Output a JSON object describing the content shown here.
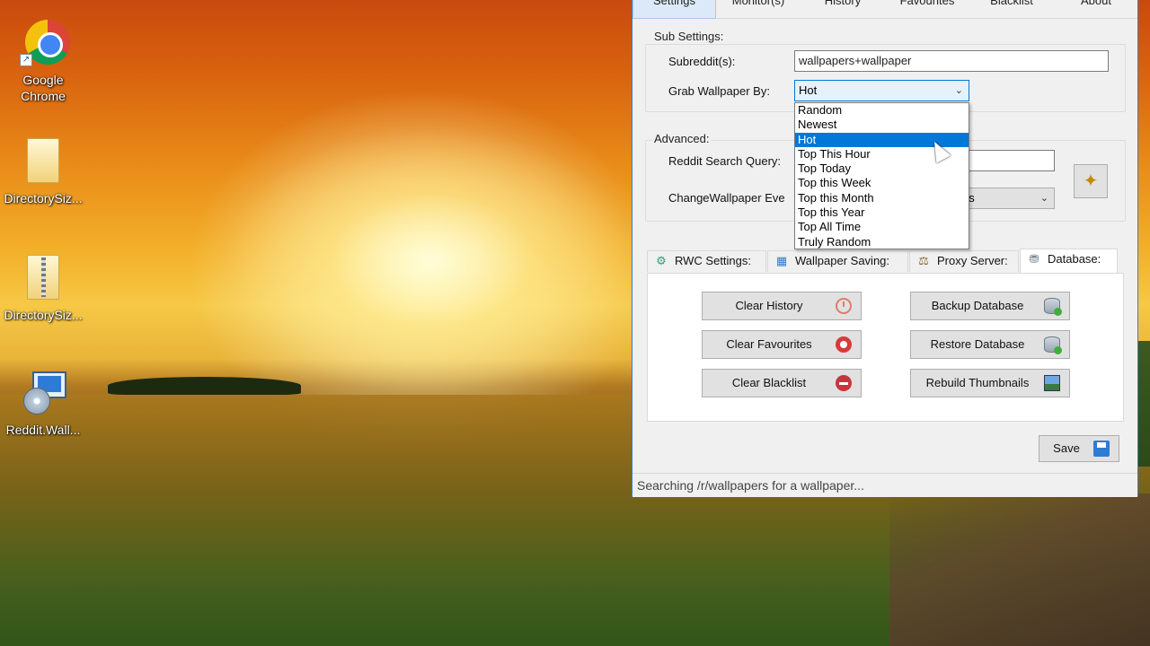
{
  "desktop": {
    "icons": [
      {
        "label": "Google Chrome",
        "icon": "chrome-icon"
      },
      {
        "label": "DirectorySiz...",
        "icon": "folder-icon"
      },
      {
        "label": "DirectorySiz...",
        "icon": "zip-folder-icon"
      },
      {
        "label": "Reddit.Wall...",
        "icon": "installer-icon"
      }
    ]
  },
  "window": {
    "tabs": [
      "Settings",
      "Monitor(s)",
      "History",
      "Favourites",
      "Blacklist",
      "About"
    ],
    "active_tab": "Settings",
    "sub_settings": {
      "title": "Sub Settings:",
      "subreddits_label": "Subreddit(s):",
      "subreddits_value": "wallpapers+wallpaper",
      "grab_label": "Grab Wallpaper By:",
      "grab_value": "Hot"
    },
    "advanced": {
      "title": "Advanced:",
      "search_label": "Reddit Search Query:",
      "change_label": "ChangeWallpaper Eve",
      "change_value_partial": "es"
    },
    "dropdown": {
      "options": [
        "Random",
        "Newest",
        "Hot",
        "Top This Hour",
        "Top Today",
        "Top this Week",
        "Top this Month",
        "Top this Year",
        "Top All Time",
        "Truly Random"
      ],
      "selected": "Hot"
    },
    "inner_tabs": [
      {
        "label": "RWC Settings:",
        "icon": "gear-icon"
      },
      {
        "label": "Wallpaper Saving:",
        "icon": "floppy-icon"
      },
      {
        "label": "Proxy Server:",
        "icon": "proxy-icon"
      },
      {
        "label": "Database:",
        "icon": "database-icon"
      }
    ],
    "active_inner_tab": "Database:",
    "database_buttons": {
      "clear_history": "Clear History",
      "clear_favourites": "Clear Favourites",
      "clear_blacklist": "Clear Blacklist",
      "backup_database": "Backup Database",
      "restore_database": "Restore Database",
      "rebuild_thumbnails": "Rebuild Thumbnails"
    },
    "save_label": "Save",
    "status": "Searching /r/wallpapers for a wallpaper..."
  },
  "colors": {
    "accent": "#0078d7",
    "window_bg": "#f0f0f0",
    "button_bg": "#e1e1e1"
  }
}
